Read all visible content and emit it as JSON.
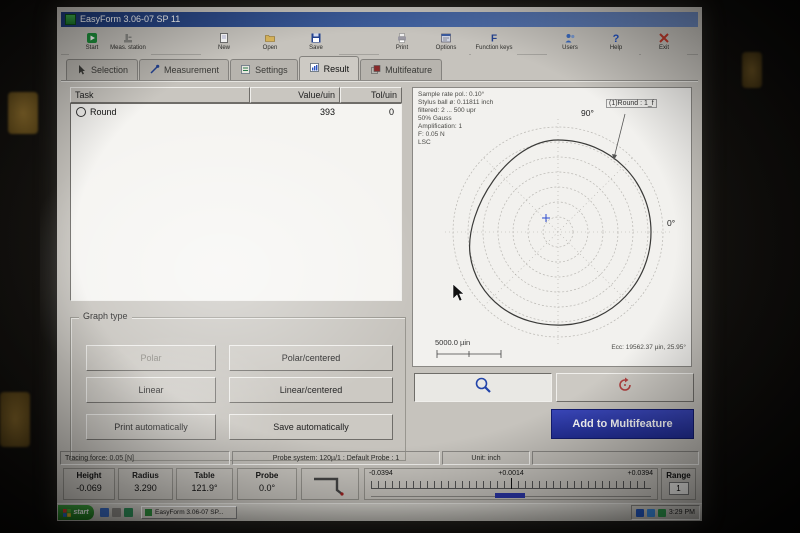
{
  "window": {
    "title": "EasyForm 3.06-07 SP 11"
  },
  "toolbar": {
    "items": [
      "Start",
      "Meas. station",
      "New",
      "Open",
      "Save",
      "Print",
      "Options",
      "Function keys",
      "Users",
      "Help",
      "Exit"
    ]
  },
  "tabs": {
    "items": [
      "Selection",
      "Measurement",
      "Settings",
      "Result",
      "Multifeature"
    ],
    "active": "Result"
  },
  "task_table": {
    "headers": {
      "task": "Task",
      "value": "Value/uin",
      "tol": "Tol/uin"
    },
    "rows": [
      {
        "task": "Round",
        "value": "393",
        "tol": "0"
      }
    ]
  },
  "graph_type": {
    "title": "Graph type",
    "buttons": [
      "Polar",
      "Polar/centered",
      "Linear",
      "Linear/centered",
      "Print automatically",
      "Save automatically"
    ]
  },
  "plot": {
    "info_lines": [
      "Sample rate pol.: 0.10°",
      "Stylus ball ø: 0.11811 inch",
      "filtered: 2 ... 500 upr",
      "50% Gauss",
      "Amplification: 1",
      "F: 0.05 N",
      "LSC"
    ],
    "angle_top": "90°",
    "angle_right": "0°",
    "callout": "(1)Round : 1_f",
    "scale_label": "5000.0 µin",
    "error_readout": "Ecc: 19562.37 µin, 25.95°"
  },
  "plot_actions": {
    "add_button": "Add to Multifeature"
  },
  "status_bar": {
    "tracing_force": "Tracing force: 0.05 [N]",
    "probe_system": "Probe system: 120µ/1 : Default Probe : 1",
    "unit": "Unit: inch"
  },
  "readouts": {
    "height": {
      "label": "Height",
      "value": "-0.069"
    },
    "radius": {
      "label": "Radius",
      "value": "3.290"
    },
    "table": {
      "label": "Table",
      "value": "121.9°"
    },
    "probe": {
      "label": "Probe",
      "value": "0.0°"
    }
  },
  "ruler": {
    "left": "-0.0394",
    "center": "+0.0014",
    "right": "+0.0394"
  },
  "range": {
    "label": "Range",
    "value": "1"
  },
  "taskbar": {
    "start_label": "start",
    "app_button": "EasyForm 3.06-07 SP...",
    "time": "3:29 PM"
  },
  "colors": {
    "accent_blue": "#2b36a8",
    "title_bar_blue": "#2f4f96",
    "start_green": "#2f8f2f",
    "exit_red": "#c0392b",
    "help_blue": "#1f4fbf"
  }
}
